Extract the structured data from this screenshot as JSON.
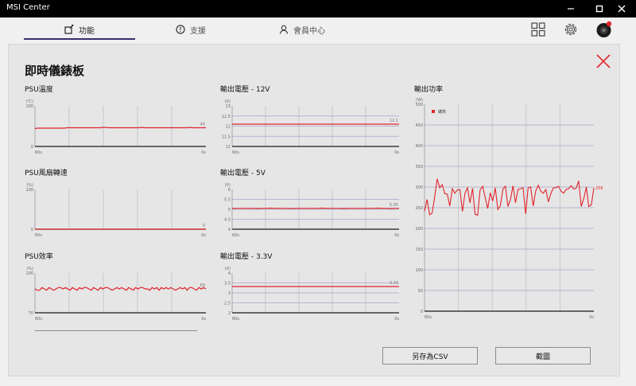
{
  "window": {
    "title": "MSI Center"
  },
  "nav": {
    "tabs": [
      {
        "label": "功能",
        "icon": "features-icon"
      },
      {
        "label": "支援",
        "icon": "support-icon"
      },
      {
        "label": "會員中心",
        "icon": "member-icon"
      }
    ],
    "icons": [
      "apps-grid-icon",
      "settings-gear-icon",
      "user-avatar-icon"
    ]
  },
  "panel": {
    "title": "即時儀錶板"
  },
  "buttons": {
    "save_csv": "另存為CSV",
    "screenshot": "截圖"
  },
  "colors": {
    "accent": "#e0252c",
    "tab_underline": "#3a2d6d"
  },
  "charts": [
    {
      "id": "psu-temp",
      "label": "PSU溫度",
      "unit": "(℃)",
      "yticks": [
        "100",
        "0"
      ],
      "ymin": 0,
      "ymax": 100,
      "xleft": "60s",
      "xright": "0s",
      "current": "46",
      "values": [
        44,
        45,
        45,
        45,
        45,
        45,
        45,
        45,
        45,
        45,
        45,
        45,
        45,
        45,
        46,
        46,
        46,
        46,
        46,
        46,
        46,
        46,
        46,
        46,
        46,
        46,
        46,
        46,
        46,
        46,
        47,
        47,
        46,
        46,
        46,
        46,
        46,
        46,
        46,
        46,
        46,
        46,
        46,
        46,
        46,
        46,
        46,
        47,
        46,
        46,
        46,
        46,
        46,
        46,
        46,
        46,
        46,
        46,
        46,
        46,
        46,
        46,
        46,
        46,
        46,
        46,
        46,
        46,
        47,
        46,
        46,
        46,
        46,
        46,
        46,
        46
      ]
    },
    {
      "id": "psu-fan",
      "label": "PSU風扇轉速",
      "unit": "(%)",
      "yticks": [
        "100",
        "0"
      ],
      "ymin": 0,
      "ymax": 100,
      "xleft": "60s",
      "xright": "0s",
      "current": "0",
      "values": [
        0,
        0,
        0,
        0,
        0,
        0,
        0,
        0,
        0,
        0,
        0,
        0,
        0,
        0,
        0,
        0,
        0,
        0,
        0,
        0,
        0,
        0,
        0,
        0,
        0,
        0,
        0,
        0,
        0,
        0,
        0,
        0,
        0,
        0,
        0,
        0,
        0,
        0,
        0,
        0,
        0,
        0,
        0,
        0,
        0,
        0,
        0,
        0,
        0,
        0,
        0,
        0,
        0,
        0,
        0,
        0,
        0,
        0,
        0,
        0,
        0,
        0,
        0,
        0
      ]
    },
    {
      "id": "psu-eff",
      "label": "PSU效率",
      "unit": "(%)",
      "yticks": [
        "100",
        "70"
      ],
      "ymin": 70,
      "ymax": 100,
      "xleft": "60s",
      "xright": "0s",
      "current": "89",
      "values": [
        88,
        87,
        87,
        89,
        88,
        87,
        89,
        88,
        87,
        88,
        89,
        89,
        88,
        89,
        88,
        87,
        89,
        88,
        87,
        89,
        88,
        89,
        89,
        88,
        87,
        89,
        88,
        87,
        89,
        88,
        89,
        89,
        88,
        87,
        88,
        89,
        88,
        89,
        88,
        87,
        89,
        88,
        87,
        89,
        88,
        89,
        89,
        88,
        88,
        87,
        89,
        88,
        89,
        87,
        89,
        88,
        89,
        88,
        89,
        88,
        87,
        88,
        89,
        88,
        89,
        87,
        89,
        89,
        88,
        87,
        89,
        88,
        89,
        88
      ]
    },
    {
      "id": "v12",
      "label": "輸出電壓 - 12V",
      "unit": "(V)",
      "yticks": [
        "13",
        "12.5",
        "12",
        "11.5",
        "11"
      ],
      "ymin": 11,
      "ymax": 13,
      "xleft": "60s",
      "xright": "0s",
      "current": "12.1",
      "values": [
        12.1,
        12.1,
        12.1,
        12.1,
        12.1,
        12.1,
        12.1,
        12.1,
        12.1,
        12.1,
        12.1,
        12.1,
        12.1,
        12.1,
        12.1,
        12.1,
        12.1,
        12.1,
        12.1,
        12.1,
        12.1,
        12.1,
        12.1,
        12.1,
        12.1,
        12.1,
        12.1,
        12.1,
        12.1,
        12.1,
        12.1,
        12.1,
        12.1,
        12.1,
        12.1,
        12.1,
        12.1,
        12.1,
        12.1,
        12.1
      ]
    },
    {
      "id": "v5",
      "label": "輸出電壓  - 5V",
      "unit": "(V)",
      "yticks": [
        "6",
        "5.5",
        "5",
        "4.5",
        "4"
      ],
      "ymin": 4,
      "ymax": 6,
      "xleft": "60s",
      "xright": "0s",
      "current": "5.05",
      "values": [
        5.04,
        5.05,
        5.05,
        5.05,
        5.05,
        5.05,
        5.04,
        5.05,
        5.05,
        5.06,
        5.05,
        5.05,
        5.05,
        5.05,
        5.04,
        5.05,
        5.05,
        5.05,
        5.05,
        5.05,
        5.05,
        5.06,
        5.05,
        5.05,
        5.05,
        5.05,
        5.04,
        5.05,
        5.05,
        5.05,
        5.05,
        5.05,
        5.05,
        5.05,
        5.06,
        5.05,
        5.05,
        5.04,
        5.05,
        5.05
      ]
    },
    {
      "id": "v33",
      "label": "輸出電壓 - 3.3V",
      "unit": "(V)",
      "yticks": [
        "4",
        "3.5",
        "3",
        "2.5",
        "2"
      ],
      "ymin": 2,
      "ymax": 4,
      "xleft": "60s",
      "xright": "0s",
      "current": "3.33",
      "values": [
        3.32,
        3.32,
        3.32,
        3.32,
        3.32,
        3.32,
        3.32,
        3.32,
        3.32,
        3.32,
        3.32,
        3.32,
        3.32,
        3.32,
        3.32,
        3.32,
        3.32,
        3.32,
        3.32,
        3.32,
        3.32,
        3.32,
        3.32,
        3.32,
        3.32,
        3.32,
        3.32,
        3.32,
        3.32,
        3.32,
        3.32,
        3.32,
        3.32,
        3.32,
        3.32,
        3.32,
        3.32,
        3.32,
        3.32,
        3.32
      ]
    },
    {
      "id": "power",
      "label": "輸出功率",
      "unit": "(W)",
      "legend": "總共",
      "yticks": [
        "500",
        "450",
        "400",
        "350",
        "300",
        "250",
        "200",
        "150",
        "100",
        "50",
        "0"
      ],
      "ymin": 0,
      "ymax": 500,
      "xleft": "60s",
      "xright": "0s",
      "current": "256",
      "values": [
        242,
        270,
        233,
        237,
        275,
        320,
        298,
        306,
        284,
        283,
        254,
        296,
        285,
        293,
        294,
        241,
        285,
        298,
        262,
        297,
        234,
        232,
        293,
        302,
        275,
        248,
        286,
        266,
        298,
        246,
        255,
        295,
        302,
        253,
        270,
        303,
        262,
        294,
        296,
        298,
        235,
        298,
        300,
        254,
        291,
        304,
        290,
        285,
        294,
        264,
        285,
        298,
        298,
        302,
        290,
        285,
        294,
        296,
        303,
        295,
        297,
        315,
        253,
        272,
        300,
        253,
        257,
        298
      ]
    }
  ]
}
